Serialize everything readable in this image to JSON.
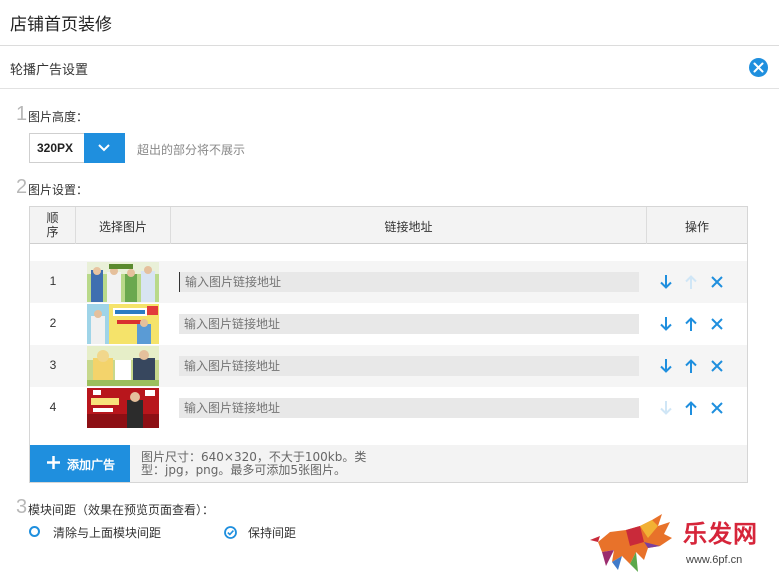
{
  "page": {
    "title": "店铺首页装修"
  },
  "panel": {
    "title": "轮播广告设置",
    "close_icon": "close-circle-icon"
  },
  "steps": {
    "step1": {
      "number": "1",
      "label": "图片高度："
    },
    "step2": {
      "number": "2",
      "label": "图片设置："
    },
    "step3": {
      "number": "3",
      "label": "模块间距（效果在预览页面查看）："
    }
  },
  "height_select": {
    "value": "320PX",
    "hint": "超出的部分将不展示"
  },
  "table": {
    "headers": {
      "order": "顺序",
      "image": "选择图片",
      "link": "链接地址",
      "actions": "操作"
    },
    "rows": [
      {
        "num": "1",
        "placeholder": "输入图片链接地址",
        "down_enabled": true,
        "up_enabled": false
      },
      {
        "num": "2",
        "placeholder": "输入图片链接地址",
        "down_enabled": true,
        "up_enabled": true
      },
      {
        "num": "3",
        "placeholder": "输入图片链接地址",
        "down_enabled": true,
        "up_enabled": true
      },
      {
        "num": "4",
        "placeholder": "输入图片链接地址",
        "down_enabled": false,
        "up_enabled": true
      }
    ]
  },
  "add_button": {
    "label": "添加广告"
  },
  "add_hint": "图片尺寸：640×320，不大于100kb。类型：jpg，png。最多可添加5张图片。",
  "spacing": {
    "options": [
      {
        "label": "清除与上面模块间距",
        "checked": false
      },
      {
        "label": "保持间距",
        "checked": true
      }
    ]
  },
  "watermark": {
    "brand": "乐发网",
    "url": "www.6pf.cn"
  },
  "colors": {
    "accent": "#1f8fde",
    "disabled": "#d0e6f6",
    "brand_red": "#d6253a"
  }
}
